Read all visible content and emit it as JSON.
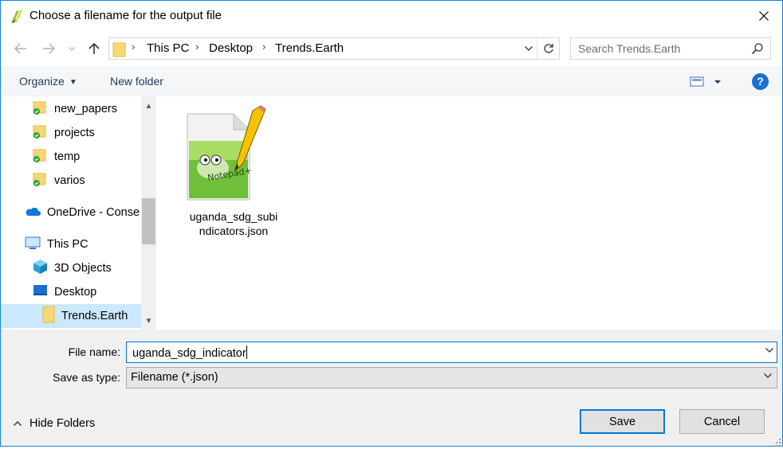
{
  "window": {
    "title": "Choose a filename for the output file"
  },
  "address_bar": {
    "breadcrumbs": [
      "This PC",
      "Desktop",
      "Trends.Earth"
    ]
  },
  "search": {
    "placeholder": "Search Trends.Earth"
  },
  "toolbar": {
    "organize_label": "Organize",
    "new_folder_label": "New folder"
  },
  "nav_pane": {
    "items": [
      {
        "label": "new_papers",
        "icon": "folder-synced-icon"
      },
      {
        "label": "projects",
        "icon": "folder-synced-icon"
      },
      {
        "label": "temp",
        "icon": "folder-synced-icon"
      },
      {
        "label": "varios",
        "icon": "folder-synced-icon"
      },
      {
        "label": "OneDrive - Conse",
        "icon": "onedrive-cloud-icon"
      },
      {
        "label": "This PC",
        "icon": "computer-icon"
      },
      {
        "label": "3D Objects",
        "icon": "cube-icon"
      },
      {
        "label": "Desktop",
        "icon": "desktop-icon"
      },
      {
        "label": "Trends.Earth",
        "icon": "folder-icon",
        "selected": true
      }
    ]
  },
  "files": [
    {
      "name": "uganda_sdg_subindicators.json",
      "display_lines": [
        "uganda_sdg_subi",
        "ndicators.json"
      ],
      "icon": "notepad-plus-plus-file-icon"
    }
  ],
  "form": {
    "file_name_label": "File name:",
    "file_name_value": "uganda_sdg_indicator",
    "save_type_label": "Save as type:",
    "save_type_value": "Filename (*.json)"
  },
  "footer": {
    "hide_folders_label": "Hide Folders",
    "save_label": "Save",
    "cancel_label": "Cancel"
  },
  "colors": {
    "accent": "#0078d7",
    "selection": "#cce8ff",
    "toolbar_text": "#1e395b",
    "folder_yellow": "#f8d775",
    "sync_green": "#2aa134"
  }
}
